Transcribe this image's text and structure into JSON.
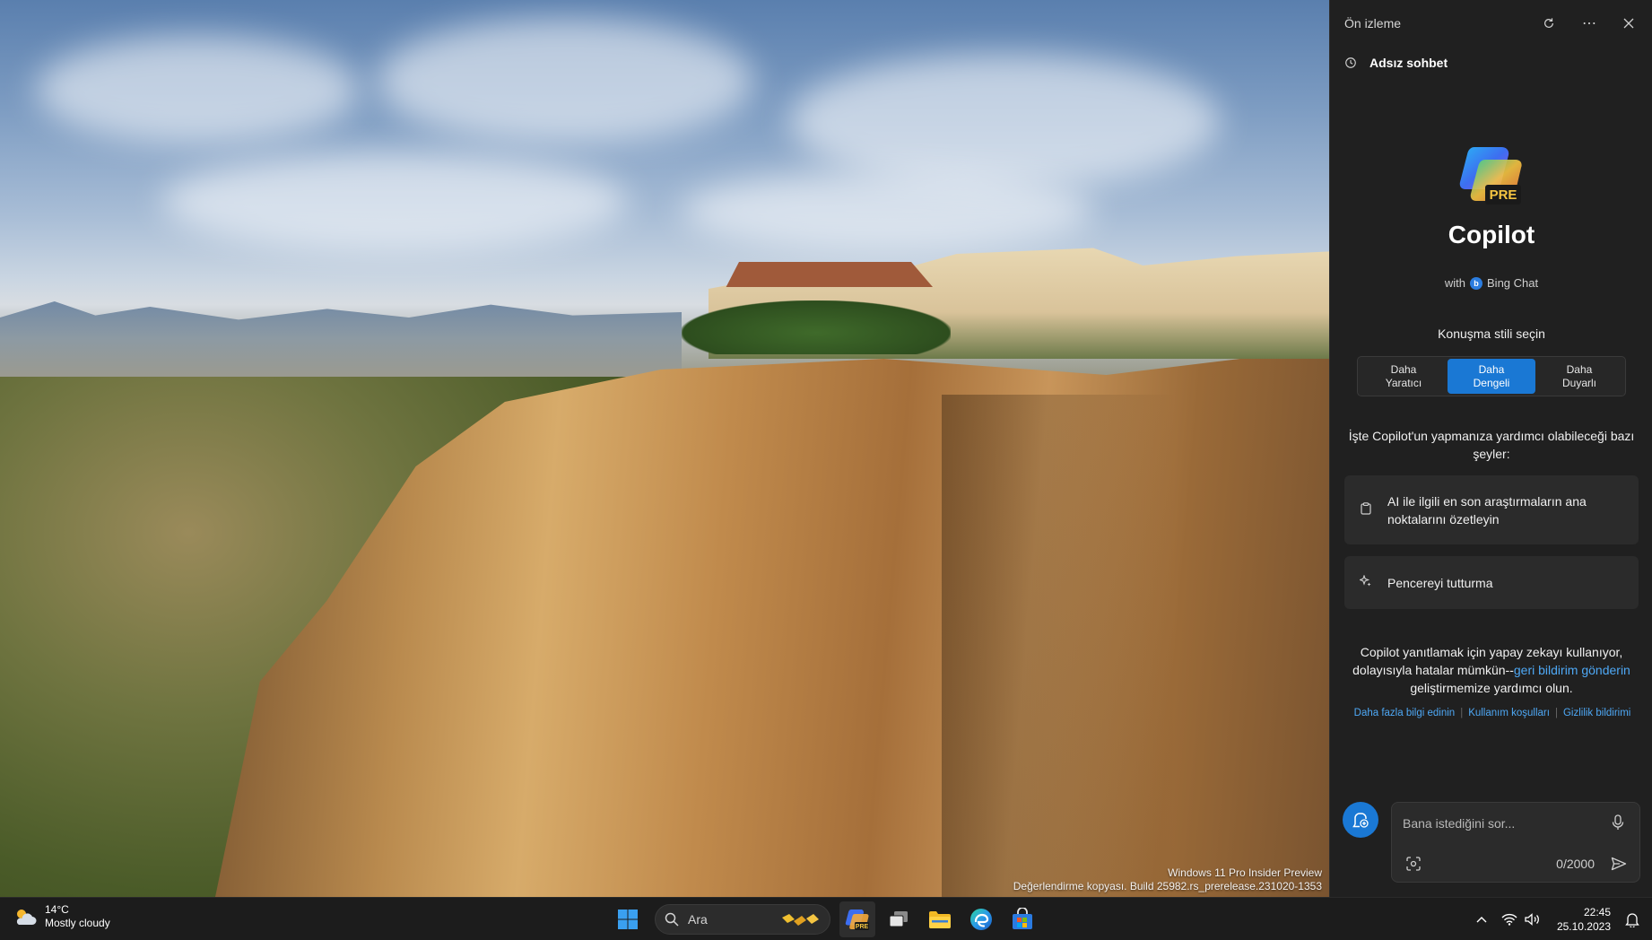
{
  "desktop": {
    "watermark_line1": "Windows 11 Pro Insider Preview",
    "watermark_line2": "Değerlendirme kopyası. Build 25982.rs_prerelease.231020-1353"
  },
  "copilot": {
    "header_title": "Ön izleme",
    "conversation_title": "Adsız sohbet",
    "logo_badge": "PRE",
    "app_name": "Copilot",
    "with_prefix": "with",
    "bing_label": "Bing Chat",
    "style_prompt": "Konuşma stili seçin",
    "styles": [
      {
        "line1": "Daha",
        "line2": "Yaratıcı"
      },
      {
        "line1": "Daha",
        "line2": "Dengeli"
      },
      {
        "line1": "Daha",
        "line2": "Duyarlı"
      }
    ],
    "intro": "İşte Copilot'un yapmanıza yardımcı olabileceği bazı şeyler:",
    "suggestions": [
      {
        "label": "AI ile ilgili en son araştırmaların ana noktalarını özetleyin",
        "icon": "clipboard-icon"
      },
      {
        "label": "Pencereyi tutturma",
        "icon": "sparkle-icon"
      }
    ],
    "disclaimer_before": "Copilot yanıtlamak için yapay zekayı kullanıyor, dolayısıyla hatalar mümkün--",
    "disclaimer_link": "geri bildirim gönderin",
    "disclaimer_after": " geliştirmemize yardımcı olun.",
    "footer_links": [
      "Daha fazla bilgi edinin",
      "Kullanım koşulları",
      "Gizlilik bildirimi"
    ],
    "input_placeholder": "Bana istediğini sor...",
    "char_counter": "0/2000",
    "accent_color": "#1a78d4",
    "link_color": "#4ea8f5"
  },
  "taskbar": {
    "temperature": "14°C",
    "weather_desc": "Mostly cloudy",
    "search_placeholder": "Ara",
    "time": "22:45",
    "date": "25.10.2023",
    "copilot_badge": "PRE"
  }
}
